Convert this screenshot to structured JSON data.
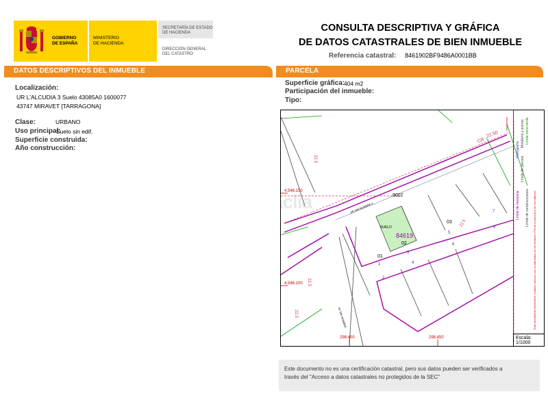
{
  "header": {
    "gov_line1": "GOBIERNO",
    "gov_line2": "DE ESPAÑA",
    "ministry_line1": "MINISTERIO",
    "ministry_line2": "DE HACIENDA",
    "secretaria_line1": "SECRETARÍA DE ESTADO",
    "secretaria_line2": "DE HACIENDA",
    "direccion_line1": "DIRECCIÓN GENERAL",
    "direccion_line2": "DEL CATASTRO",
    "title_line1": "CONSULTA DESCRIPTIVA Y GRÁFICA",
    "title_line2": "DE DATOS CATASTRALES DE BIEN INMUEBLE",
    "ref_label": "Referencia catastral:",
    "ref_value": "8461902BF9486A0001BB"
  },
  "datos": {
    "section_title": "DATOS DESCRIPTIVOS DEL INMUEBLE",
    "localizacion_label": "Localización:",
    "localizacion_line1": "UR L'ALCUDIA 3 Suelo 43085A0 1600077",
    "localizacion_line2": "43747 MIRAVET [TARRAGONA]",
    "clase_label": "Clase:",
    "clase_value": "URBANO",
    "uso_label": "Uso principal:",
    "uso_value": "Suelo sin edif.",
    "superficie_label": "Superficie construida:",
    "anio_label": "Año construcción:"
  },
  "parcela": {
    "section_title": "PARCELA",
    "superficie_label": "Superficie gráfica:",
    "superficie_value": "404 m2",
    "participacion_label": "Participación del inmueble:",
    "tipo_label": "Tipo:"
  },
  "map": {
    "parcel_label": "SUELO",
    "parcel_number": "84619",
    "block_9007": "9007",
    "n01": "01",
    "n02": "02",
    "n03": "03",
    "n1": "1",
    "n2": "2",
    "n3": "3",
    "n4": "4",
    "n5": "5",
    "n6": "6",
    "n7": "7",
    "n8": "8",
    "coord_y1": "4.546.150",
    "coord_y2": "4.546.100",
    "coord_x1": "298.400",
    "coord_x2": "298.450",
    "road_cr": "CR",
    "road_width": "22.50",
    "w225a": "22.5",
    "w225b": "22.5",
    "w225c": "22.5",
    "w225d": "22.5",
    "street1": "UR SIN NOMBRE 4",
    "street2": "AV SIN NOMBRE",
    "watermark": "habitaclia",
    "legend_items": [
      "Límite de manzana",
      "Límite de parcela",
      "Límite de construcciones",
      "Mobiliario y aceras",
      "Límite zona verde",
      "Hidrografía"
    ],
    "note": "Este documento electrónico contiene anexos con coordenadas de los vértices UTM de la parcela y de los edificios"
  },
  "scale": {
    "label": "Escala:",
    "value": "1/1000"
  },
  "footer": {
    "notice_line1": "Este documento no es una certificación catastral, pero sus datos pueden ser verificados a",
    "notice_line2": "través del \"Acceso a datos catastrales no protegidos de la SEC\""
  },
  "colors": {
    "accent_orange": "#f28c1c",
    "gov_yellow": "#ffd200",
    "parcel_purple": "#a000a0",
    "zone_green": "#00a000",
    "highlight_parcel": "#c8f0c0"
  }
}
